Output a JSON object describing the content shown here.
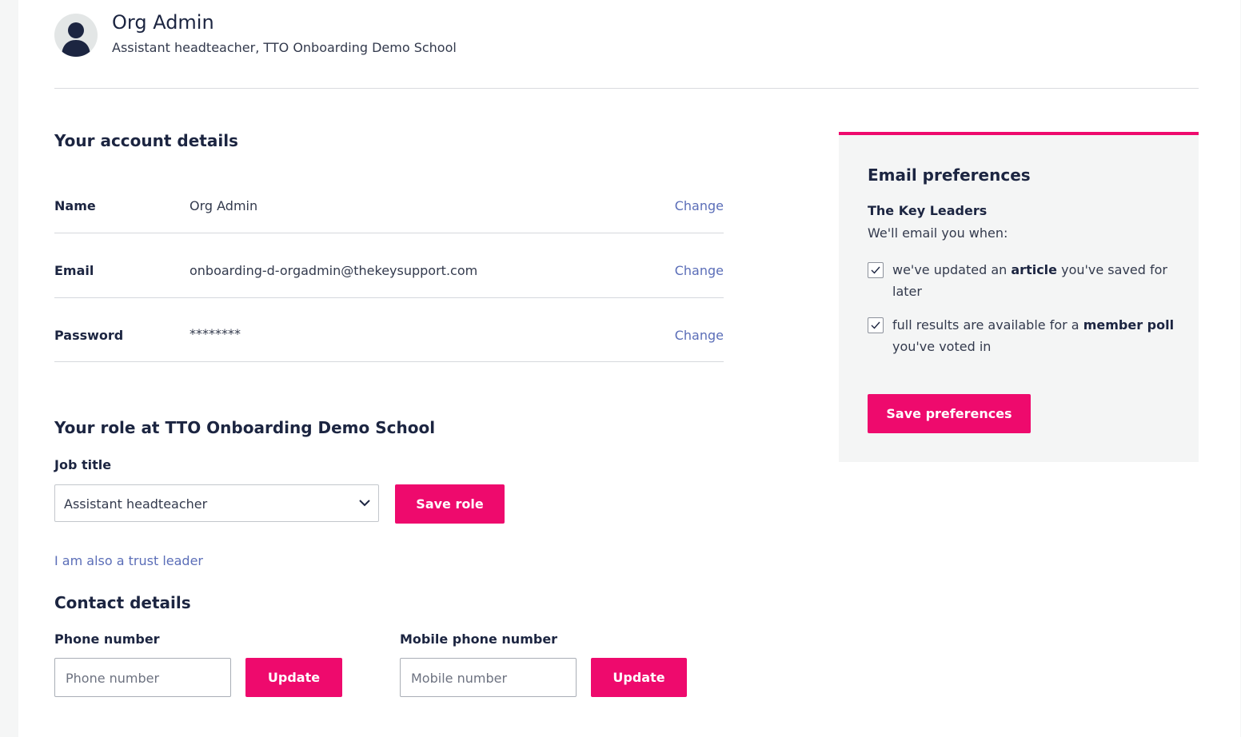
{
  "profile": {
    "name": "Org Admin",
    "subtitle": "Assistant headteacher, TTO Onboarding Demo School"
  },
  "account": {
    "heading": "Your account details",
    "rows": [
      {
        "label": "Name",
        "value": "Org Admin",
        "action": "Change"
      },
      {
        "label": "Email",
        "value": "onboarding-d-orgadmin@thekeysupport.com",
        "action": "Change"
      },
      {
        "label": "Password",
        "value": "********",
        "action": "Change"
      }
    ]
  },
  "role": {
    "heading": "Your role at TTO Onboarding Demo School",
    "job_title_label": "Job title",
    "selected": "Assistant headteacher",
    "save_label": "Save role",
    "trust_leader_link": "I am also a trust leader"
  },
  "contact": {
    "heading": "Contact details",
    "phone_label": "Phone number",
    "phone_placeholder": "Phone number",
    "mobile_label": "Mobile phone number",
    "mobile_placeholder": "Mobile number",
    "update_label": "Update"
  },
  "email_prefs": {
    "heading": "Email preferences",
    "group_title": "The Key Leaders",
    "intro": "We'll email you when:",
    "options": [
      {
        "pre": "we've updated an ",
        "bold": "article",
        "post": " you've saved for later",
        "checked": true
      },
      {
        "pre": "full results are available for a ",
        "bold": "member poll",
        "post": " you've voted in",
        "checked": true
      }
    ],
    "save_label": "Save preferences"
  },
  "colors": {
    "accent": "#ee0a6d",
    "link": "#5b6eb8",
    "text": "#1c2541",
    "panel_bg": "#f4f5f5"
  },
  "icons": {
    "avatar": "user-silhouette-icon",
    "select": "chevron-down-icon",
    "checkbox": "checkmark-icon"
  }
}
